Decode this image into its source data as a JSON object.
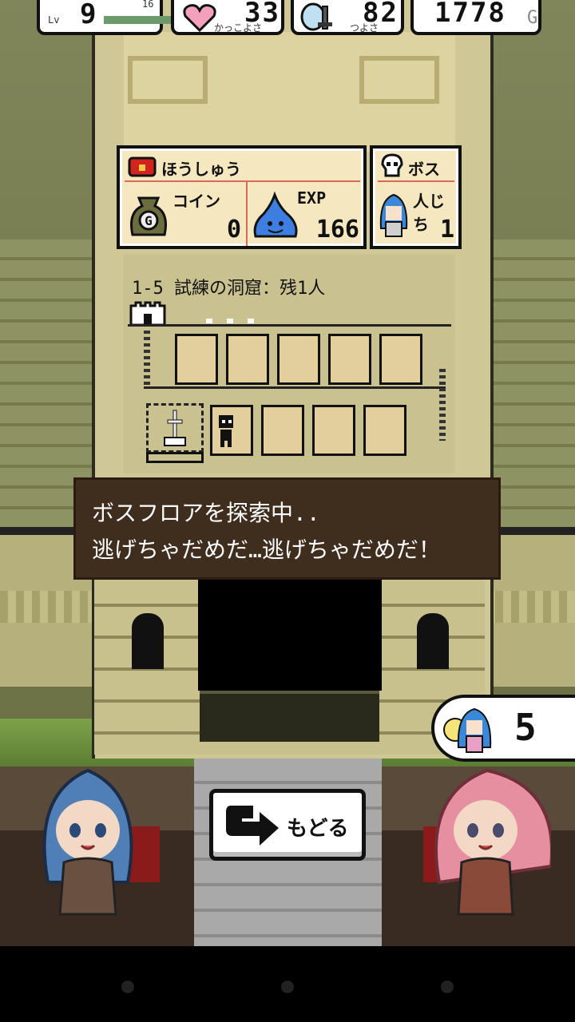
{
  "stats": {
    "level": {
      "prefix": "Lv",
      "value": "9",
      "next": "16",
      "progress": 0.85
    },
    "charm": {
      "value": "33",
      "label": "かっこよさ",
      "icon": "heart-icon"
    },
    "power": {
      "value": "82",
      "label": "つよさ",
      "icon": "sword-shield-icon"
    },
    "gold": {
      "value": "1778",
      "unit": "G"
    }
  },
  "reward": {
    "title": "ほうしゅう",
    "coin_label": "コイン",
    "coin_value": "0",
    "exp_label": "EXP",
    "exp_value": "166"
  },
  "boss": {
    "title": "ボス",
    "hostage_label": "人じち",
    "hostage_value": "1"
  },
  "stage": {
    "label": "1-5 試練の洞窟：残1人"
  },
  "message": {
    "line1": "ボスフロアを探索中..",
    "line2": "逃げちゃだめだ…逃げちゃだめだ！"
  },
  "hostage_counter": {
    "value": "5"
  },
  "back_button": {
    "label": "もどる"
  },
  "colors": {
    "panel_bg": "#f5e7c0",
    "message_bg": "#3f2d1e",
    "accent": "#d86a58"
  }
}
